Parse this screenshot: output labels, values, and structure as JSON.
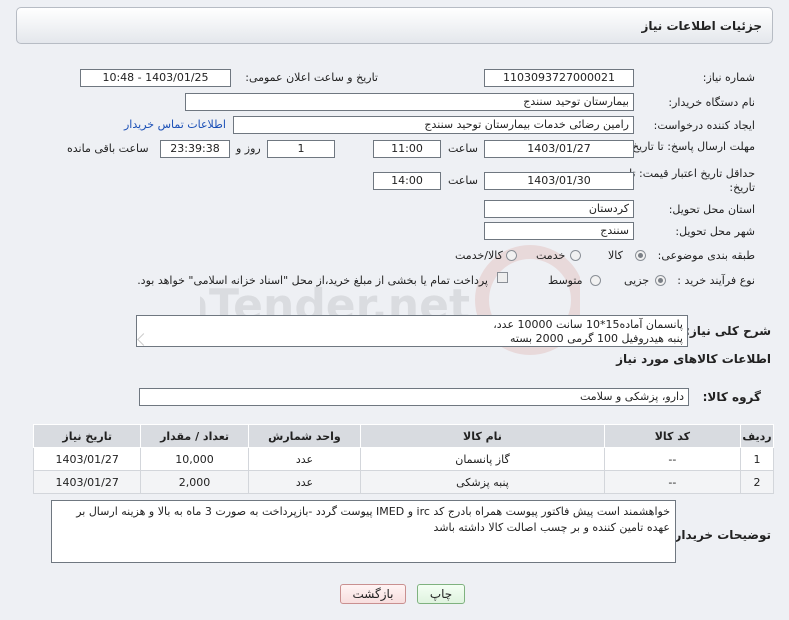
{
  "header": {
    "title": "جزئیات اطلاعات نیاز"
  },
  "form": {
    "need_number": {
      "label": "شماره نیاز:",
      "value": "1103093727000021"
    },
    "announce_datetime": {
      "label": "تاریخ و ساعت اعلان عمومی:",
      "value": "1403/01/25 - 10:48"
    },
    "buyer_org": {
      "label": "نام دستگاه خریدار:",
      "value": "بیمارستان توحید سنندج"
    },
    "requester": {
      "label": "ایجاد کننده درخواست:",
      "value": "رامین رضائی خدمات بیمارستان توحید سنندج",
      "contact_link": "اطلاعات تماس خریدار"
    },
    "reply_deadline": {
      "label": "مهلت ارسال پاسخ: تا تاریخ:",
      "date": "1403/01/27",
      "time_label": "ساعت",
      "time": "11:00",
      "days": "1",
      "days_label": "روز و",
      "remaining": "23:39:38",
      "remaining_label": "ساعت باقی مانده"
    },
    "price_validity": {
      "label": "حداقل تاریخ اعتبار قیمت: تا تاریخ:",
      "date": "1403/01/30",
      "time_label": "ساعت",
      "time": "14:00"
    },
    "delivery_province": {
      "label": "استان محل تحویل:",
      "value": "کردستان"
    },
    "delivery_city": {
      "label": "شهر محل تحویل:",
      "value": "سنندج"
    },
    "category": {
      "label": "طبقه بندی موضوعی:",
      "options": [
        "کالا",
        "خدمت",
        "کالا/خدمت"
      ]
    },
    "purchase_type": {
      "label": "نوع فرآیند خرید :",
      "options": [
        "جزیی",
        "متوسط"
      ],
      "note": "پرداخت تمام یا بخشی از مبلغ خرید،از محل \"اسناد خزانه اسلامی\" خواهد بود."
    }
  },
  "summary": {
    "label": "شرح کلی نیاز:",
    "line1": "پانسمان آماده15*10 سانت       10000 عدد،",
    "line2": "پنبه هیدروفیل 100 گرمی          2000 بسته"
  },
  "goods": {
    "section_title": "اطلاعات کالاهای مورد نیاز",
    "group_label": "گروه کالا:",
    "group_value": "دارو، پزشکی و سلامت",
    "columns": [
      "ردیف",
      "کد کالا",
      "نام کالا",
      "واحد شمارش",
      "تعداد / مقدار",
      "تاریخ نیاز"
    ],
    "rows": [
      [
        "1",
        "--",
        "گاز پانسمان",
        "عدد",
        "10,000",
        "1403/01/27"
      ],
      [
        "2",
        "--",
        "پنبه پزشکی",
        "عدد",
        "2,000",
        "1403/01/27"
      ]
    ]
  },
  "buyer_notes": {
    "label": "توضیحات خریدار:",
    "text": "خواهشمند است پیش فاکتور پیوست همراه بادرج کد irc و IMED  پیوست گردد -بازپرداخت به صورت 3 ماه به بالا و هزینه ارسال بر عهده تامین کننده و بر چسب اصالت کالا داشته باشد"
  },
  "buttons": {
    "print": "چاپ",
    "back": "بازگشت"
  },
  "watermark_text": "AriaTender.net"
}
